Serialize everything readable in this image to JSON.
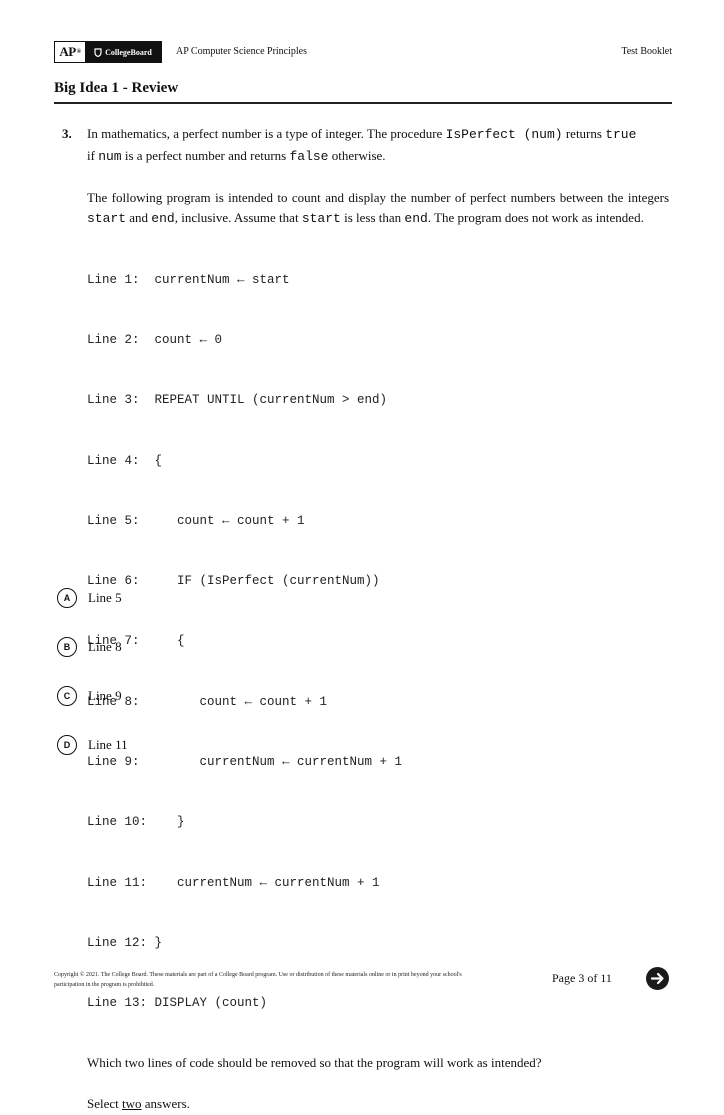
{
  "header": {
    "logo_ap": "AP",
    "logo_ap_mark": "®",
    "logo_collegeboard": "CollegeBoard",
    "course": "AP Computer Science Principles",
    "booklet": "Test Booklet"
  },
  "section_title": "Big Idea 1 - Review",
  "question": {
    "number": "3.",
    "intro": {
      "t1": "In mathematics, a perfect number is a type of integer. The procedure ",
      "c1": "IsPerfect (num)",
      "t2": " returns ",
      "c2": "true",
      "t3": "if ",
      "c3": "num",
      "t4": " is a perfect number and returns ",
      "c4": "false",
      "t5": " otherwise."
    },
    "para2": {
      "t1": "The following program is intended to count and display the number of perfect numbers between the integers ",
      "c1": "start",
      "t2": " and ",
      "c2": "end",
      "t3": ", inclusive. Assume that ",
      "c3": "start",
      "t4": " is less than ",
      "c4": "end",
      "t5": ". The program does not work as intended."
    },
    "code_lines": [
      "Line 1:  currentNum ← start",
      "Line 2:  count ← 0",
      "Line 3:  REPEAT UNTIL (currentNum > end)",
      "Line 4:  {",
      "Line 5:     count ← count + 1",
      "Line 6:     IF (IsPerfect (currentNum))",
      "Line 7:     {",
      "Line 8:        count ← count + 1",
      "Line 9:        currentNum ← currentNum + 1",
      "Line 10:    }",
      "Line 11:    currentNum ← currentNum + 1",
      "Line 12: }",
      "Line 13: DISPLAY (count)"
    ],
    "prompt": "Which two lines of code should be removed so that the program will work as intended?",
    "instruction_pre": "Select ",
    "instruction_emph": "two",
    "instruction_post": " answers.",
    "choices": [
      {
        "letter": "A",
        "label": "Line 5"
      },
      {
        "letter": "B",
        "label": "Line 8"
      },
      {
        "letter": "C",
        "label": "Line 9"
      },
      {
        "letter": "D",
        "label": "Line 11"
      }
    ]
  },
  "footer": {
    "copyright": "Copyright © 2021. The College Board. These materials are part of a College Board program. Use or distribution of these materials online or in print beyond your school's participation in the program is prohibited.",
    "page": "Page 3 of 11",
    "next_icon": "arrow-right-circle-icon"
  }
}
